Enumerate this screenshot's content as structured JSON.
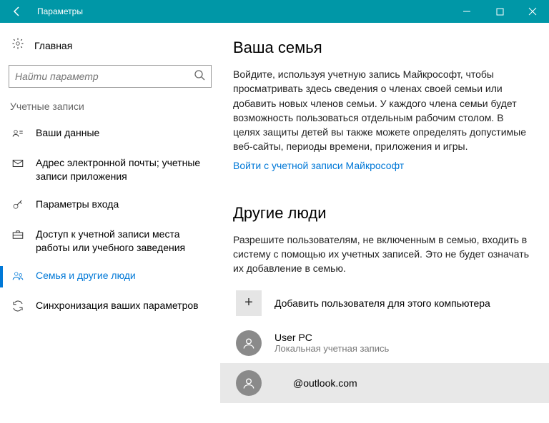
{
  "titlebar": {
    "title": "Параметры"
  },
  "sidebar": {
    "home": "Главная",
    "search_placeholder": "Найти параметр",
    "section": "Учетные записи",
    "items": [
      {
        "label": "Ваши данные"
      },
      {
        "label": "Адрес электронной почты; учетные записи приложения"
      },
      {
        "label": "Параметры входа"
      },
      {
        "label": "Доступ к учетной записи места работы или учебного заведения"
      },
      {
        "label": "Семья и другие люди"
      },
      {
        "label": "Синхронизация ваших параметров"
      }
    ]
  },
  "family": {
    "heading": "Ваша семья",
    "text": "Войдите, используя учетную запись Майкрософт, чтобы просматривать здесь сведения о членах своей семьи или добавить новых членов семьи. У каждого члена семьи будет возможность пользоваться отдельным рабочим столом. В целях защиты детей вы также можете определять допустимые веб-сайты, периоды времени, приложения и игры.",
    "link": "Войти с учетной записи Майкрософт"
  },
  "others": {
    "heading": "Другие люди",
    "text": "Разрешите пользователям, не включенным в семью, входить в систему с помощью их учетных записей. Это не будет означать их добавление в семью.",
    "add": "Добавить пользователя для этого компьютера",
    "users": [
      {
        "name": "User PC",
        "sub": "Локальная учетная запись"
      },
      {
        "name": "@outlook.com",
        "sub": ""
      }
    ]
  }
}
